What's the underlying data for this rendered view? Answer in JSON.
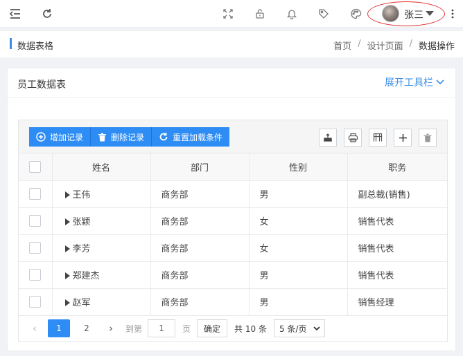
{
  "user": {
    "name": "张三"
  },
  "breadcrumb": {
    "title": "数据表格",
    "items": [
      "首页",
      "设计页面",
      "数据操作"
    ],
    "separator": "/"
  },
  "card": {
    "title": "员工数据表",
    "expand_label": "展开工具栏"
  },
  "toolbar": {
    "add_label": "增加记录",
    "delete_label": "删除记录",
    "reset_label": "重置加载条件"
  },
  "table": {
    "columns": [
      "姓名",
      "部门",
      "性别",
      "职务"
    ],
    "rows": [
      {
        "name": "王伟",
        "dept": "商务部",
        "gender": "男",
        "title": "副总裁(销售)"
      },
      {
        "name": "张颖",
        "dept": "商务部",
        "gender": "女",
        "title": "销售代表"
      },
      {
        "name": "李芳",
        "dept": "商务部",
        "gender": "女",
        "title": "销售代表"
      },
      {
        "name": "郑建杰",
        "dept": "商务部",
        "gender": "男",
        "title": "销售代表"
      },
      {
        "name": "赵军",
        "dept": "商务部",
        "gender": "男",
        "title": "销售经理"
      }
    ]
  },
  "pager": {
    "pages": [
      "1",
      "2"
    ],
    "goto_label": "到第",
    "page_value": "1",
    "page_unit": "页",
    "confirm_label": "确定",
    "total": "共 10 条",
    "page_size": "5 条/页"
  },
  "colors": {
    "accent": "#2e8df5",
    "highlight_circle": "#e0302f"
  }
}
